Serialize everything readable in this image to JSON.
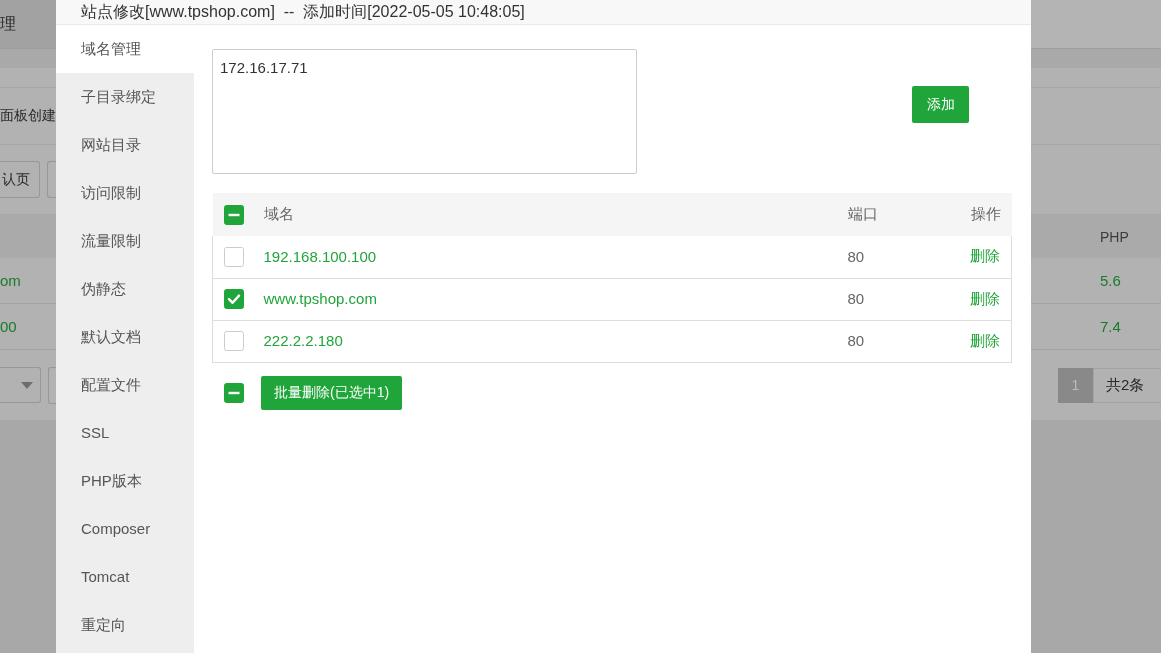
{
  "page_behind": {
    "breadcrumb": "理",
    "notice": "面板创建",
    "toolbar_button": "认页",
    "php_column": "PHP",
    "rows": [
      {
        "domain": "om",
        "php": "5.6"
      },
      {
        "domain": "00",
        "php": "7.4"
      }
    ],
    "pagination": {
      "pages": [
        {
          "label": "1",
          "selected": true
        }
      ],
      "total": "共2条"
    }
  },
  "dialog": {
    "title": "站点修改[www.tpshop.com]  --  添加时间[2022-05-05 10:48:05]",
    "menu": [
      {
        "label": "域名管理",
        "selected": true
      },
      {
        "label": "子目录绑定",
        "selected": false
      },
      {
        "label": "网站目录",
        "selected": false
      },
      {
        "label": "访问限制",
        "selected": false
      },
      {
        "label": "流量限制",
        "selected": false
      },
      {
        "label": "伪静态",
        "selected": false
      },
      {
        "label": "默认文档",
        "selected": false
      },
      {
        "label": "配置文件",
        "selected": false
      },
      {
        "label": "SSL",
        "selected": false
      },
      {
        "label": "PHP版本",
        "selected": false
      },
      {
        "label": "Composer",
        "selected": false
      },
      {
        "label": "Tomcat",
        "selected": false
      },
      {
        "label": "重定向",
        "selected": false
      }
    ],
    "domain_input": {
      "value": "172.16.17.71"
    },
    "add_button": "添加",
    "table": {
      "select_all": {
        "partial": true
      },
      "columns": [
        "域名",
        "端口",
        "操作"
      ],
      "rows": [
        {
          "checked": false,
          "domain": "192.168.100.100",
          "port": "80",
          "action": "删除"
        },
        {
          "checked": true,
          "domain": "www.tpshop.com",
          "port": "80",
          "action": "删除"
        },
        {
          "checked": false,
          "domain": "222.2.2.180",
          "port": "80",
          "action": "删除"
        }
      ]
    },
    "batch": {
      "select_all": {
        "partial": true
      },
      "button": "批量删除(已选中1)"
    }
  }
}
